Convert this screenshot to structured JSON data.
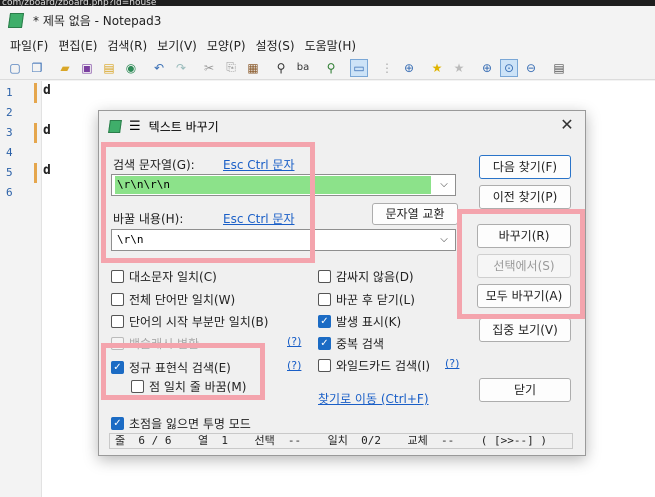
{
  "bg_strip": "com/zboard/zboard.php?id=house",
  "window": {
    "title": "* 제목 없음 - Notepad3"
  },
  "menu": [
    "파일(F)",
    "편집(E)",
    "검색(R)",
    "보기(V)",
    "모양(P)",
    "설정(S)",
    "도움말(H)"
  ],
  "toolbar_icons": [
    "new-icon",
    "new-window-icon",
    "open-icon",
    "save-icon",
    "save-as-icon",
    "revert-icon",
    "undo-icon",
    "redo-icon",
    "cut-icon",
    "copy-icon",
    "paste-icon",
    "find-icon",
    "replace-icon",
    "find-in-files-icon",
    "toggle-view-icon",
    "select-icon",
    "zoom-find-icon",
    "favorite-icon",
    "add-favorite-icon",
    "zoom-in-icon",
    "zoom-reset-icon",
    "zoom-out-icon",
    "settings-icon"
  ],
  "editor": {
    "line_numbers": [
      "1",
      "2",
      "3",
      "4",
      "5",
      "6"
    ],
    "lines": [
      "d",
      "",
      "d",
      "",
      "d",
      ""
    ]
  },
  "dialog": {
    "title": "텍스트 바꾸기",
    "search_label": "검색 문자열(G):",
    "search_link": "Esc Ctrl 문자",
    "search_value": "\\r\\n\\r\\n",
    "replace_label": "바꿀 내용(H):",
    "replace_link": "Esc Ctrl 문자",
    "replace_value": "\\r\\n",
    "swap_button": "문자열 교환",
    "buttons": {
      "find_next": "다음 찾기(F)",
      "find_prev": "이전 찾기(P)",
      "replace": "바꾸기(R)",
      "replace_in_selection": "선택에서(S)",
      "replace_all": "모두 바꾸기(A)",
      "focus_view": "집중 보기(V)",
      "close": "닫기"
    },
    "options_left": {
      "match_case": "대소문자 일치(C)",
      "whole_word": "전체 단어만 일치(W)",
      "word_start": "단어의 시작 부분만 일치(B)",
      "backslash": "백슬래시 변환",
      "regex": "정규 표현식 검색(E)",
      "dot_matches_all": "점 일치 줄 바꿈(M)",
      "transparent": "초점을 잃으면 투명 모드"
    },
    "options_right": {
      "no_wrap": "감싸지 않음(D)",
      "close_after_replace": "바꾼 후 닫기(L)",
      "mark_occurrences": "발생 표시(K)",
      "duplicate_search": "중복 검색",
      "wildcard": "와일드카드 검색(I)"
    },
    "help_mark": "(?)",
    "goto_link": "찾기로 이동 (Ctrl+F)",
    "status": "줄  6 / 6    열  1    선택  --    일치  0/2    교체  --    ( [>>--] )"
  }
}
